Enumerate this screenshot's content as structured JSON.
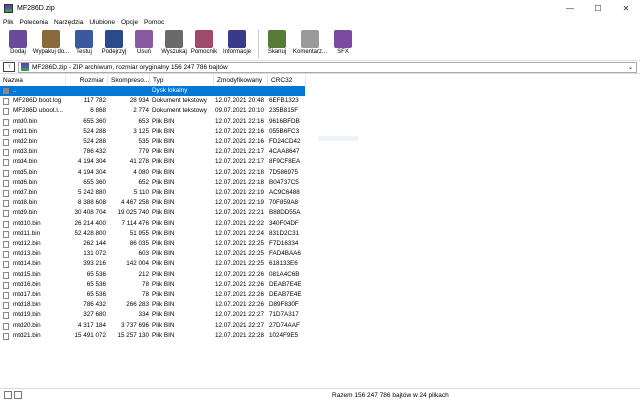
{
  "window": {
    "title": "MF286D.zip",
    "min": "—",
    "max": "☐",
    "close": "✕"
  },
  "menu": [
    "Plik",
    "Polecenia",
    "Narzędzia",
    "Ulubione",
    "Opcje",
    "Pomoc"
  ],
  "toolbar": [
    {
      "label": "Dodaj",
      "icon": "add-icon",
      "color": "#6a4a9a"
    },
    {
      "label": "Wypakuj do...",
      "icon": "extract-icon",
      "color": "#8a6a3a"
    },
    {
      "label": "Testuj",
      "icon": "test-icon",
      "color": "#3a5aa0"
    },
    {
      "label": "Podejrzyj",
      "icon": "view-icon",
      "color": "#2a4a8a"
    },
    {
      "label": "Usuń",
      "icon": "delete-icon",
      "color": "#8a5aa0"
    },
    {
      "label": "Wyszukaj",
      "icon": "find-icon",
      "color": "#6a6a6a"
    },
    {
      "label": "Pomocnik",
      "icon": "wizard-icon",
      "color": "#a04a6a"
    },
    {
      "label": "Informacje",
      "icon": "info-icon",
      "color": "#3a3a8a"
    },
    {
      "label": "Skanuj",
      "icon": "scan-icon",
      "color": "#5a7a3a"
    },
    {
      "label": "Komentarz...",
      "icon": "comment-icon",
      "color": "#9a9a9a"
    },
    {
      "label": "SFX",
      "icon": "sfx-icon",
      "color": "#7a4aa0"
    }
  ],
  "address": {
    "up_label": "↑",
    "text": "MF286D.zip - ZIP archiwum, rozmiar oryginalny 156 247 786 bajtów",
    "dropdown": "⌄"
  },
  "columns": [
    "Nazwa",
    "Rozmiar",
    "Skompreso...",
    "Typ",
    "Zmodyfikowany",
    "CRC32"
  ],
  "rows": [
    {
      "name": "..",
      "size": "",
      "packed": "",
      "type": "Dysk lokalny",
      "modified": "",
      "crc": "",
      "selected": true,
      "up": true
    },
    {
      "name": "MF286D boot.log",
      "size": "117 782",
      "packed": "28 934",
      "type": "Dokument tekstowy",
      "modified": "12.07.2021 20:48",
      "crc": "6EFB1323"
    },
    {
      "name": "MF286D uboot.l...",
      "size": "6 868",
      "packed": "2 774",
      "type": "Dokument tekstowy",
      "modified": "09.07.2021 20:10",
      "crc": "235B815F"
    },
    {
      "name": "mtd0.bin",
      "size": "655 360",
      "packed": "653",
      "type": "Plik BIN",
      "modified": "12.07.2021 22:16",
      "crc": "9616BFDB"
    },
    {
      "name": "mtd1.bin",
      "size": "524 288",
      "packed": "3 125",
      "type": "Plik BIN",
      "modified": "12.07.2021 22:16",
      "crc": "055B6FC3"
    },
    {
      "name": "mtd2.bin",
      "size": "524 288",
      "packed": "535",
      "type": "Plik BIN",
      "modified": "12.07.2021 22:16",
      "crc": "FD24CD42"
    },
    {
      "name": "mtd3.bin",
      "size": "786 432",
      "packed": "779",
      "type": "Plik BIN",
      "modified": "12.07.2021 22:17",
      "crc": "4CAA8647"
    },
    {
      "name": "mtd4.bin",
      "size": "4 194 304",
      "packed": "41 278",
      "type": "Plik BIN",
      "modified": "12.07.2021 22:17",
      "crc": "8F9CF8EA"
    },
    {
      "name": "mtd5.bin",
      "size": "4 194 304",
      "packed": "4 080",
      "type": "Plik BIN",
      "modified": "12.07.2021 22:18",
      "crc": "7D586975"
    },
    {
      "name": "mtd6.bin",
      "size": "655 360",
      "packed": "652",
      "type": "Plik BIN",
      "modified": "12.07.2021 22:18",
      "crc": "B04737C5"
    },
    {
      "name": "mtd7.bin",
      "size": "5 242 880",
      "packed": "5 110",
      "type": "Plik BIN",
      "modified": "12.07.2021 22:19",
      "crc": "AC9C6488"
    },
    {
      "name": "mtd8.bin",
      "size": "8 388 608",
      "packed": "4 467 258",
      "type": "Plik BIN",
      "modified": "12.07.2021 22:19",
      "crc": "70F859A8"
    },
    {
      "name": "mtd9.bin",
      "size": "30 408 704",
      "packed": "19 025 740",
      "type": "Plik BIN",
      "modified": "12.07.2021 22:21",
      "crc": "B88DD55A"
    },
    {
      "name": "mtd10.bin",
      "size": "26 214 400",
      "packed": "7 114 476",
      "type": "Plik BIN",
      "modified": "12.07.2021 22:22",
      "crc": "340F04DF"
    },
    {
      "name": "mtd11.bin",
      "size": "52 428 800",
      "packed": "51 955",
      "type": "Plik BIN",
      "modified": "12.07.2021 22:24",
      "crc": "831D2C31"
    },
    {
      "name": "mtd12.bin",
      "size": "262 144",
      "packed": "86 035",
      "type": "Plik BIN",
      "modified": "12.07.2021 22:25",
      "crc": "F7D16334"
    },
    {
      "name": "mtd13.bin",
      "size": "131 072",
      "packed": "603",
      "type": "Plik BIN",
      "modified": "12.07.2021 22:25",
      "crc": "FAD4BAA6"
    },
    {
      "name": "mtd14.bin",
      "size": "393 216",
      "packed": "142 004",
      "type": "Plik BIN",
      "modified": "12.07.2021 22:25",
      "crc": "618133E6"
    },
    {
      "name": "mtd15.bin",
      "size": "65 536",
      "packed": "212",
      "type": "Plik BIN",
      "modified": "12.07.2021 22:26",
      "crc": "081A4C6B"
    },
    {
      "name": "mtd16.bin",
      "size": "65 536",
      "packed": "78",
      "type": "Plik BIN",
      "modified": "12.07.2021 22:26",
      "crc": "DEAB7E4E"
    },
    {
      "name": "mtd17.bin",
      "size": "65 536",
      "packed": "78",
      "type": "Plik BIN",
      "modified": "12.07.2021 22:26",
      "crc": "DEAB7E4E"
    },
    {
      "name": "mtd18.bin",
      "size": "786 432",
      "packed": "266 283",
      "type": "Plik BIN",
      "modified": "12.07.2021 22:26",
      "crc": "D89F830F"
    },
    {
      "name": "mtd19.bin",
      "size": "327 680",
      "packed": "334",
      "type": "Plik BIN",
      "modified": "12.07.2021 22:27",
      "crc": "71D7A317"
    },
    {
      "name": "mtd20.bin",
      "size": "4 317 184",
      "packed": "3 737 696",
      "type": "Plik BIN",
      "modified": "12.07.2021 22:27",
      "crc": "27D74AAF"
    },
    {
      "name": "mtd21.bin",
      "size": "15 491 072",
      "packed": "15 257 130",
      "type": "Plik BIN",
      "modified": "12.07.2021 22:28",
      "crc": "1024F9E5"
    }
  ],
  "status": {
    "text": "Razem 156 247 786 bajtów w 24 plikach"
  },
  "colors": {
    "selection": "#0078d7"
  }
}
